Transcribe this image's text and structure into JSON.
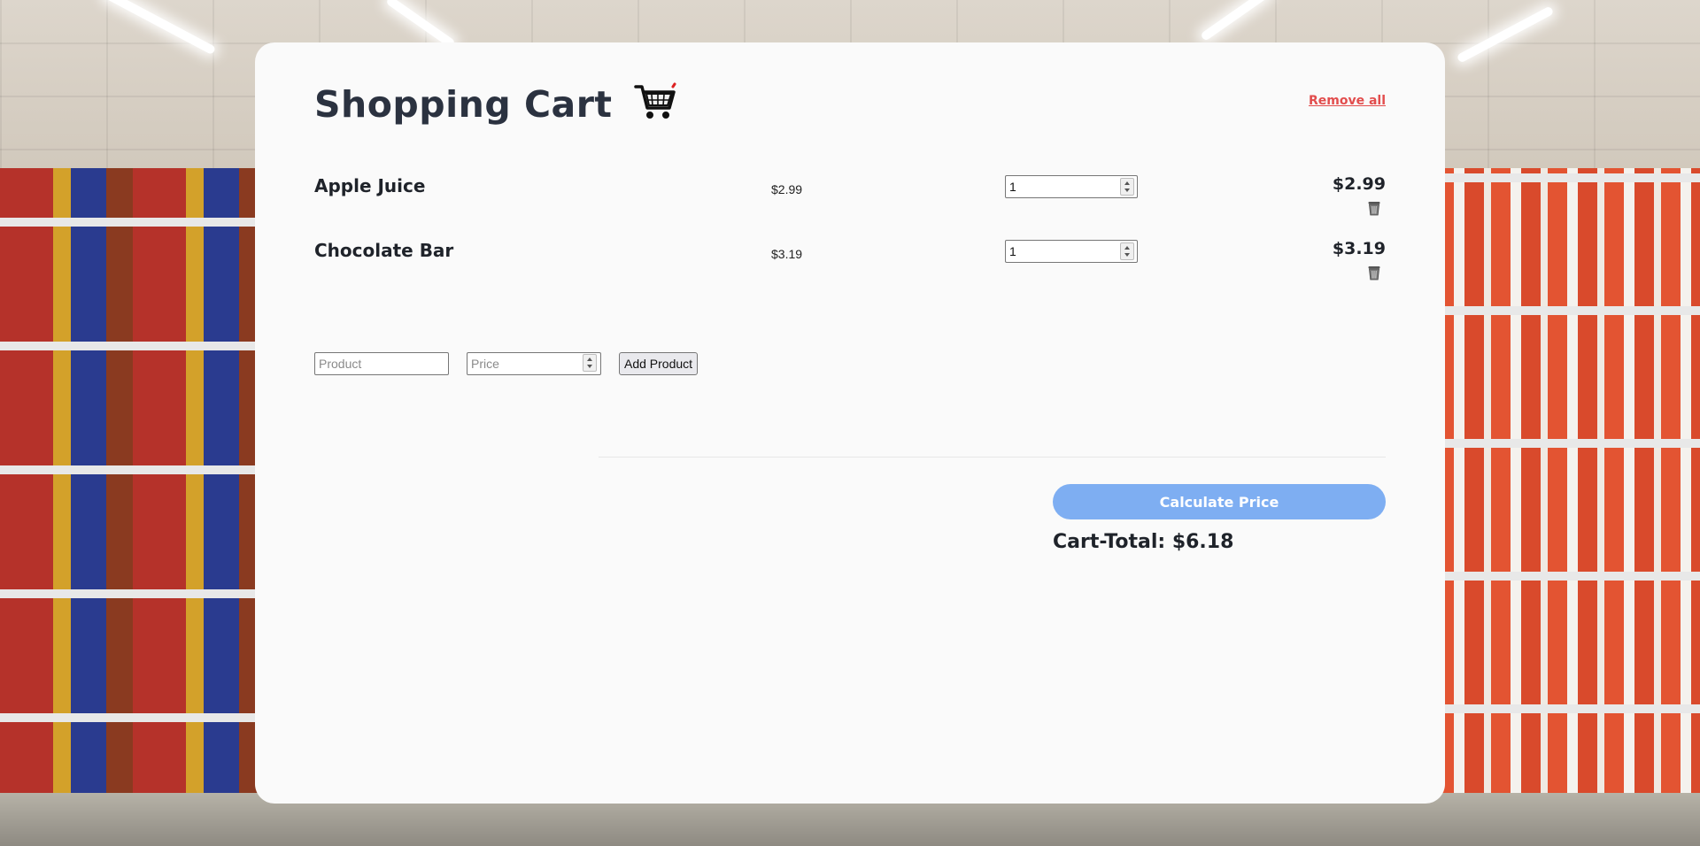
{
  "header": {
    "title": "Shopping Cart",
    "remove_all_label": "Remove all"
  },
  "items": [
    {
      "name": "Apple Juice",
      "unit_price": "$2.99",
      "quantity": "1",
      "total": "$2.99"
    },
    {
      "name": "Chocolate Bar",
      "unit_price": "$3.19",
      "quantity": "1",
      "total": "$3.19"
    }
  ],
  "add_form": {
    "product_placeholder": "Product",
    "price_placeholder": "Price",
    "add_button_label": "Add Product"
  },
  "summary": {
    "calculate_label": "Calculate Price",
    "cart_total": "Cart-Total: $6.18"
  },
  "colors": {
    "accent_button": "#7eaef2",
    "danger_link": "#e24d4d",
    "title_text": "#2b3240"
  },
  "icons": {
    "title_icon": "shopping-cart-icon",
    "row_action_icon": "trash-icon"
  }
}
